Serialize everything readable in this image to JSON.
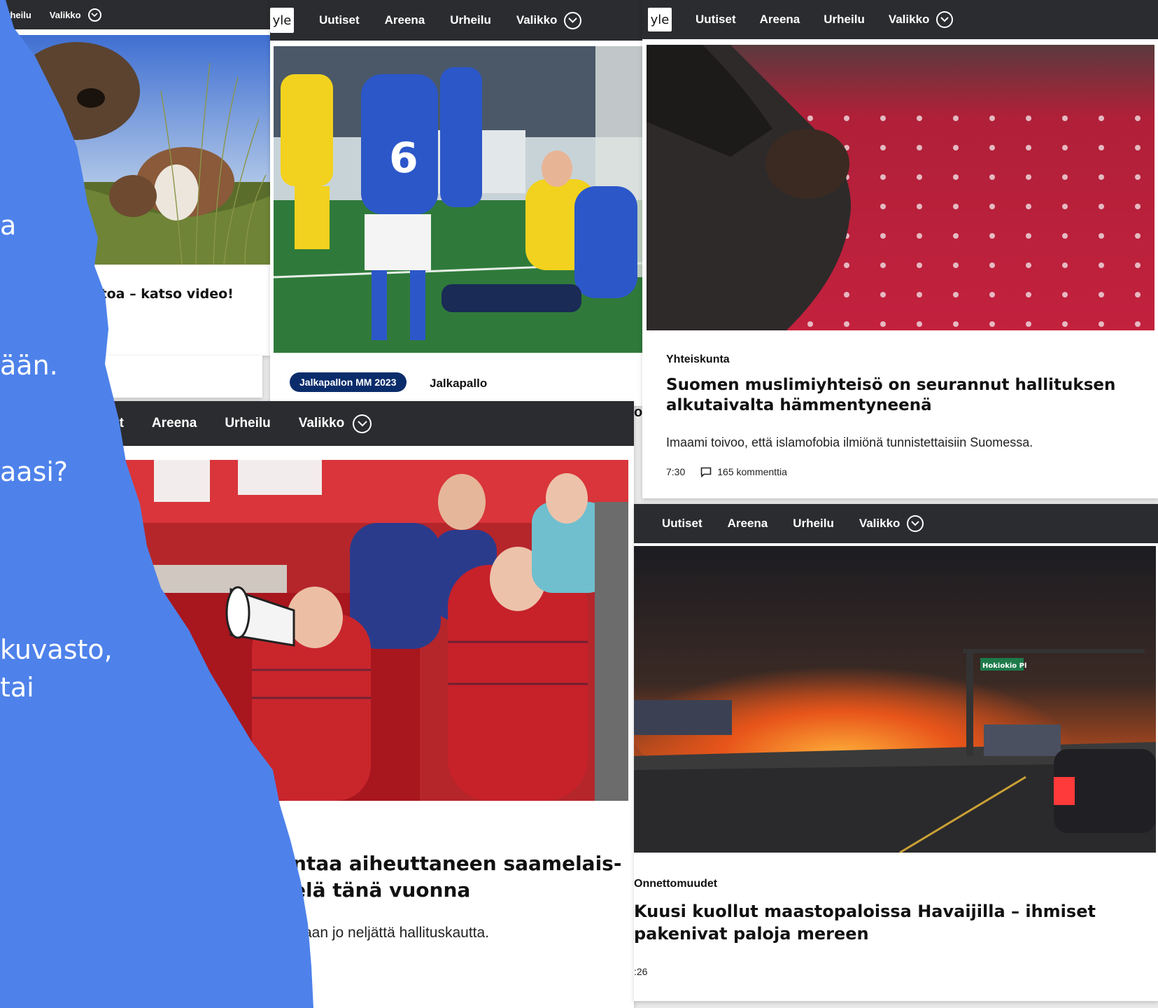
{
  "nav": {
    "logo": "yle",
    "uutiset": "Uutiset",
    "areena": "Areena",
    "urheilu": "Urheilu",
    "valikko": "Valikko",
    "partial_uutiset": "et"
  },
  "card_cows": {
    "headline_fragment": "ntoa – katso video!"
  },
  "card_football": {
    "pill": "Jalkapallon MM 2023",
    "tag": "Jalkapallo"
  },
  "card_mosque": {
    "category": "Yhteiskunta",
    "headline_line1": "Suomen muslimiyhteisö on seurannut hallituksen",
    "headline_line2": "alkutaivalta hämmentyneenä",
    "lead": "Imaami toivoo, että islamofobia ilmiönä tunnistettaisiin Suomessa.",
    "time": "7:30",
    "comments": "165 kommenttia"
  },
  "card_sami": {
    "headline_line1": "ntaa aiheuttaneen saamelais-",
    "headline_line2": "elä tänä vuonna",
    "lead": "aan jo neljättä hallituskautta."
  },
  "card_fire": {
    "category": "Onnettomuudet",
    "headline_line1": "Kuusi kuollut maastopaloissa Havaijilla – ihmiset",
    "headline_line2": "pakenivat paloja mereen",
    "time": ":26",
    "street_sign": "Hokiokio Pl"
  },
  "blue_panel": {
    "line1": "a",
    "line2": "ään.",
    "line3": "aasi?",
    "line4": "kuvasto,",
    "line5": "tai"
  },
  "stray_glyph": "o",
  "colors": {
    "yle_nav": "#2b2c2f",
    "blue_panel": "#4e82ea",
    "pill": "#0b2c6b",
    "carpet": "#c3213e",
    "fire": "#e8551a"
  }
}
